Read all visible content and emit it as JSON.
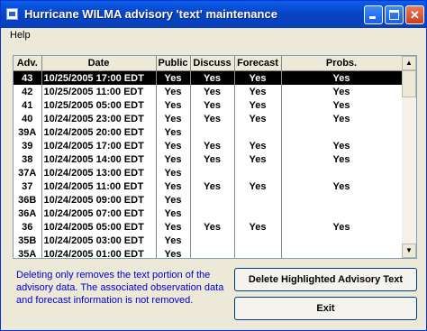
{
  "window": {
    "title": "Hurricane WILMA advisory 'text' maintenance"
  },
  "menu": [
    "Help"
  ],
  "table": {
    "headers": [
      "Adv.",
      "Date",
      "Public",
      "Discuss",
      "Forecast",
      "Probs."
    ],
    "selected_index": 0,
    "rows": [
      {
        "adv": "43",
        "date": "10/25/2005 17:00 EDT",
        "public": "Yes",
        "discuss": "Yes",
        "forecast": "Yes",
        "probs": "Yes"
      },
      {
        "adv": "42",
        "date": "10/25/2005 11:00 EDT",
        "public": "Yes",
        "discuss": "Yes",
        "forecast": "Yes",
        "probs": "Yes"
      },
      {
        "adv": "41",
        "date": "10/25/2005 05:00 EDT",
        "public": "Yes",
        "discuss": "Yes",
        "forecast": "Yes",
        "probs": "Yes"
      },
      {
        "adv": "40",
        "date": "10/24/2005 23:00 EDT",
        "public": "Yes",
        "discuss": "Yes",
        "forecast": "Yes",
        "probs": "Yes"
      },
      {
        "adv": "39A",
        "date": "10/24/2005 20:00 EDT",
        "public": "Yes",
        "discuss": "",
        "forecast": "",
        "probs": ""
      },
      {
        "adv": "39",
        "date": "10/24/2005 17:00 EDT",
        "public": "Yes",
        "discuss": "Yes",
        "forecast": "Yes",
        "probs": "Yes"
      },
      {
        "adv": "38",
        "date": "10/24/2005 14:00 EDT",
        "public": "Yes",
        "discuss": "Yes",
        "forecast": "Yes",
        "probs": "Yes"
      },
      {
        "adv": "37A",
        "date": "10/24/2005 13:00 EDT",
        "public": "Yes",
        "discuss": "",
        "forecast": "",
        "probs": ""
      },
      {
        "adv": "37",
        "date": "10/24/2005 11:00 EDT",
        "public": "Yes",
        "discuss": "Yes",
        "forecast": "Yes",
        "probs": "Yes"
      },
      {
        "adv": "36B",
        "date": "10/24/2005 09:00 EDT",
        "public": "Yes",
        "discuss": "",
        "forecast": "",
        "probs": ""
      },
      {
        "adv": "36A",
        "date": "10/24/2005 07:00 EDT",
        "public": "Yes",
        "discuss": "",
        "forecast": "",
        "probs": ""
      },
      {
        "adv": "36",
        "date": "10/24/2005 05:00 EDT",
        "public": "Yes",
        "discuss": "Yes",
        "forecast": "Yes",
        "probs": "Yes"
      },
      {
        "adv": "35B",
        "date": "10/24/2005 03:00 EDT",
        "public": "Yes",
        "discuss": "",
        "forecast": "",
        "probs": ""
      },
      {
        "adv": "35A",
        "date": "10/24/2005 01:00 EDT",
        "public": "Yes",
        "discuss": "",
        "forecast": "",
        "probs": ""
      }
    ]
  },
  "note": "Deleting only removes the text portion of the advisory data.  The associated observation data and forecast information is not removed.",
  "buttons": {
    "delete_label": "Delete Highlighted Advisory Text",
    "exit_label": "Exit"
  },
  "icons": {
    "app": "app-icon",
    "minimize": "minimize-icon",
    "maximize": "maximize-icon",
    "close": "close-icon",
    "scroll_up": "arrow-up-icon",
    "scroll_down": "arrow-down-icon"
  },
  "colors": {
    "titlebar": "#0A5FE9",
    "note_text": "#0000CC",
    "selected_row": "#000000"
  }
}
